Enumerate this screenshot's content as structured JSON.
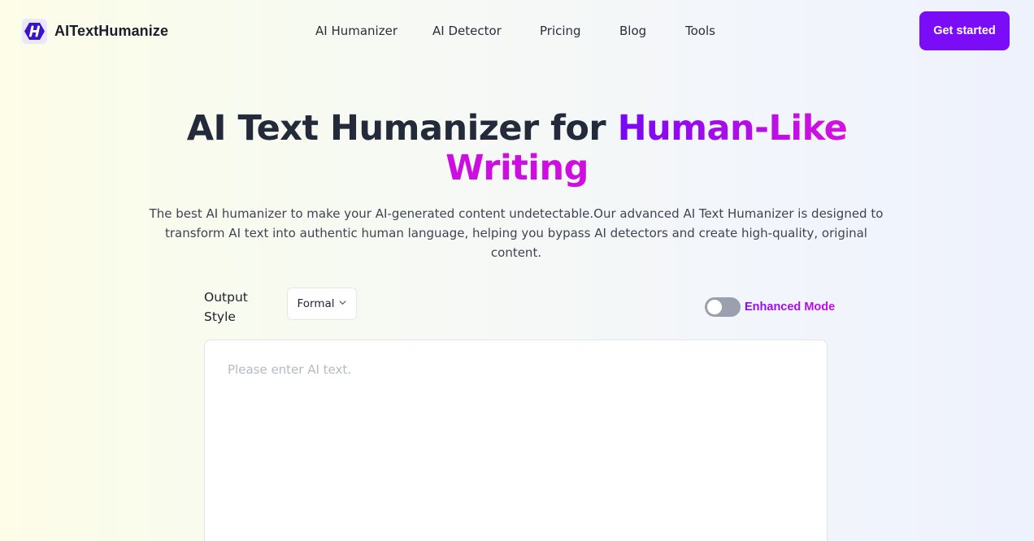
{
  "header": {
    "brand": "AITextHumanize",
    "logo_icon": "h-hexagon-logo",
    "nav": [
      "AI Humanizer",
      "AI Detector",
      "Pricing",
      "Blog",
      "Tools"
    ],
    "cta_label": "Get started"
  },
  "hero": {
    "title_plain": "AI Text Humanizer for ",
    "title_highlight": "Human-Like",
    "title_line2": "Writing",
    "subtitle": "The best AI humanizer to make your AI-generated content undetectable.Our advanced AI Text Humanizer is designed to transform AI text into authentic human language, helping you bypass AI detectors and create high-quality, original content."
  },
  "controls": {
    "output_style_label": "Output Style",
    "output_style_value": "Formal",
    "enhanced_mode_label": "Enhanced Mode",
    "enhanced_mode_on": false
  },
  "editor": {
    "placeholder": "Please enter AI text.",
    "value": ""
  },
  "colors": {
    "brand": "#7a0cf7",
    "accent_pink": "#d412df",
    "toggle_off": "#9aa0ad"
  }
}
